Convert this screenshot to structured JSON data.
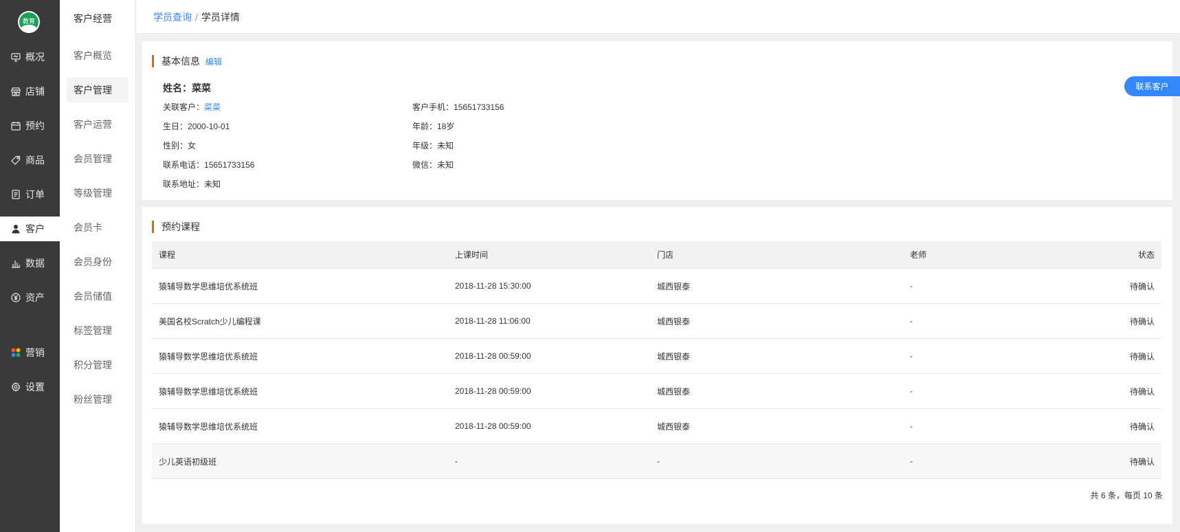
{
  "logo": {
    "text": "教育"
  },
  "primary_nav": [
    {
      "label": "概况",
      "icon": "dashboard-icon"
    },
    {
      "label": "店铺",
      "icon": "shop-icon"
    },
    {
      "label": "预约",
      "icon": "calendar-icon"
    },
    {
      "label": "商品",
      "icon": "tag-icon"
    },
    {
      "label": "订单",
      "icon": "order-icon"
    },
    {
      "label": "客户",
      "icon": "user-icon",
      "active": true
    },
    {
      "label": "数据",
      "icon": "bar-chart-icon"
    },
    {
      "label": "资产",
      "icon": "yen-icon"
    },
    {
      "label": "营销",
      "icon": "apps-icon"
    },
    {
      "label": "设置",
      "icon": "gear-icon"
    }
  ],
  "secondary_nav": {
    "title": "客户经营",
    "items": [
      "客户概览",
      "客户管理",
      "客户运营",
      "会员管理",
      "等级管理",
      "会员卡",
      "会员身份",
      "会员储值",
      "标签管理",
      "积分管理",
      "粉丝管理"
    ],
    "active_index": 1
  },
  "breadcrumb": {
    "parent": "学员查询",
    "separator": "/",
    "current": "学员详情"
  },
  "basic_info": {
    "title": "基本信息",
    "edit_label": "编辑",
    "name_label": "姓名：",
    "name_value": "菜菜",
    "left_fields": [
      {
        "label": "关联客户：",
        "value": "菜菜",
        "link": true
      },
      {
        "label": "生日：",
        "value": "2000-10-01"
      },
      {
        "label": "性别：",
        "value": "女"
      },
      {
        "label": "联系电话：",
        "value": "15651733156"
      },
      {
        "label": "联系地址：",
        "value": "未知"
      }
    ],
    "right_fields": [
      {
        "label": "客户手机：",
        "value": "15651733156"
      },
      {
        "label": "年龄：",
        "value": "18岁"
      },
      {
        "label": "年级：",
        "value": "未知"
      },
      {
        "label": "微信：",
        "value": "未知"
      }
    ]
  },
  "contact_button": "联系客户",
  "courses": {
    "title": "预约课程",
    "columns": [
      "课程",
      "上课时间",
      "门店",
      "老师",
      "状态"
    ],
    "rows": [
      [
        "猿辅导数学思维培优系统班",
        "2018-11-28 15:30:00",
        "城西银泰",
        "-",
        "待确认"
      ],
      [
        "美国名校Scratch少儿编程课",
        "2018-11-28 11:06:00",
        "城西银泰",
        "-",
        "待确认"
      ],
      [
        "猿辅导数学思维培优系统班",
        "2018-11-28 00:59:00",
        "城西银泰",
        "-",
        "待确认"
      ],
      [
        "猿辅导数学思维培优系统班",
        "2018-11-28 00:59:00",
        "城西银泰",
        "-",
        "待确认"
      ],
      [
        "猿辅导数学思维培优系统班",
        "2018-11-28 00:59:00",
        "城西银泰",
        "-",
        "待确认"
      ],
      [
        "少儿英语初级班",
        "-",
        "-",
        "-",
        "待确认"
      ]
    ],
    "pager": "共 6 条，每页 10 条"
  }
}
